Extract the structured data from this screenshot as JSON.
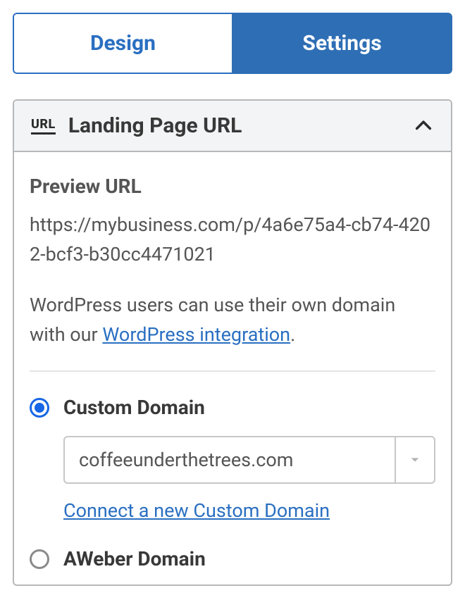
{
  "tabs": {
    "design_label": "Design",
    "settings_label": "Settings"
  },
  "panel": {
    "badge": "URL",
    "title": "Landing Page URL"
  },
  "preview": {
    "label": "Preview URL",
    "url": "https://mybusiness.com/p/4a6e75a4-cb74-4202-bcf3-b30cc4471021"
  },
  "wordpress": {
    "prefix": "WordPress users can use their own domain with our ",
    "link_text": "WordPress integration",
    "suffix": "."
  },
  "domain_options": {
    "custom_label": "Custom Domain",
    "selected_domain": "coffeeunderthetrees.com",
    "connect_link": "Connect a new Custom Domain",
    "aweber_label": "AWeber Domain"
  }
}
